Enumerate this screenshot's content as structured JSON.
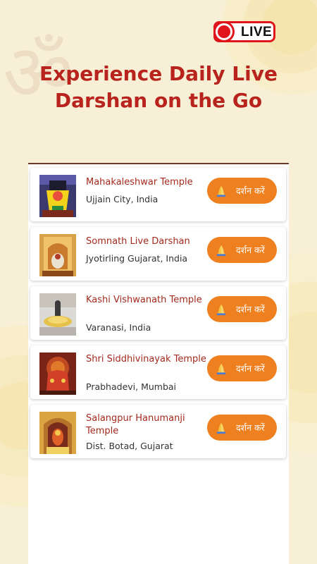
{
  "badge": {
    "label": "LIVE"
  },
  "headline": {
    "line1": "Experience Daily Live",
    "line2": "Darshan on the Go"
  },
  "temples": [
    {
      "name": "Mahakaleshwar Temple",
      "location": "Ujjain City, India",
      "button_label": "दर्शन करें"
    },
    {
      "name": "Somnath Live Darshan",
      "location": "Jyotirling Gujarat, India",
      "button_label": "दर्शन करें"
    },
    {
      "name": "Kashi Vishwanath Temple",
      "location": "Varanasi, India",
      "button_label": "दर्शन करें"
    },
    {
      "name": "Shri Siddhivinayak Temple",
      "location": "Prabhadevi, Mumbai",
      "button_label": "दर्शन करें"
    },
    {
      "name": "Salangpur Hanumanji Temple",
      "location": "Dist. Botad, Gujarat",
      "button_label": "दर्शन करें"
    }
  ],
  "colors": {
    "background": "#f7efd6",
    "headline": "#b8241d",
    "button": "#ef8020",
    "title": "#a32a1e",
    "live": "#e0141b"
  },
  "icons": {
    "badge": "record-dot-icon",
    "button": "praying-hands-icon",
    "background": "om-symbol-icon"
  }
}
